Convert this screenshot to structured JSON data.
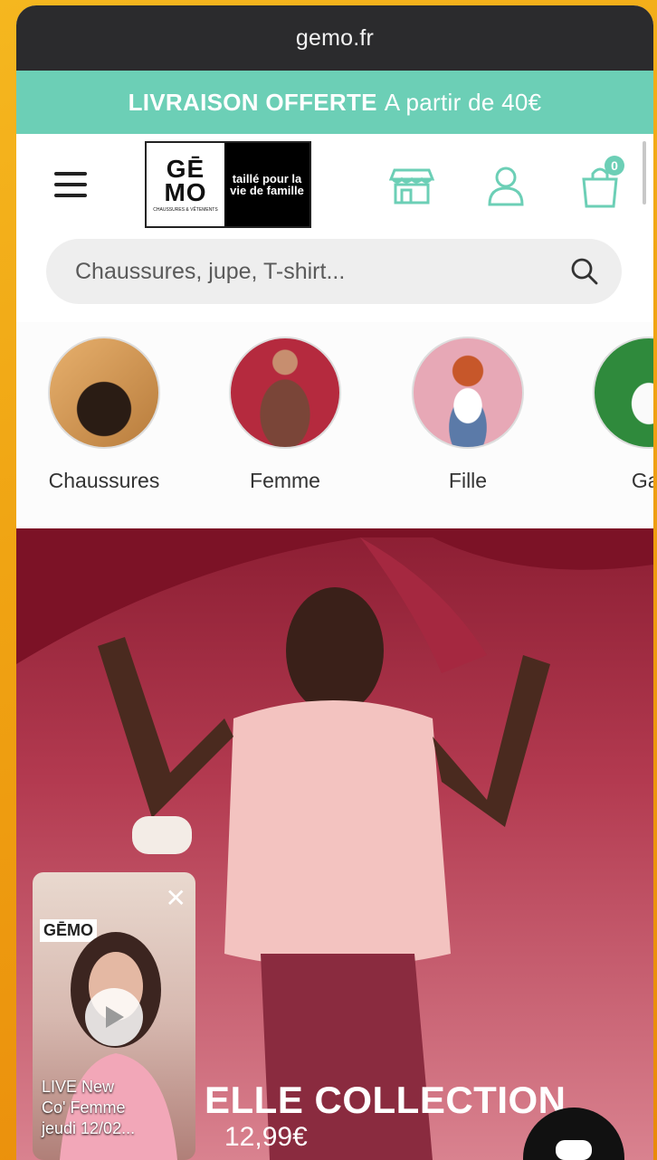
{
  "browser": {
    "url": "gemo.fr"
  },
  "promo": {
    "bold": "LIVRAISON OFFERTE",
    "rest": "A partir de 40€"
  },
  "header": {
    "logo_main_1": "GĒ",
    "logo_main_2": "MO",
    "logo_small": "CHAUSSURES & VÊTEMENTS",
    "logo_tagline": "taillé pour la vie de famille",
    "cart_count": "0"
  },
  "search": {
    "placeholder": "Chaussures, jupe, T-shirt..."
  },
  "categories": [
    {
      "label": "Chaussures"
    },
    {
      "label": "Femme"
    },
    {
      "label": "Fille"
    },
    {
      "label": "Gar"
    }
  ],
  "hero": {
    "title": "ELLE COLLECTION",
    "price": "12,99€"
  },
  "video": {
    "logo": "GĒMO",
    "caption_1": "LIVE New",
    "caption_2": "Co' Femme",
    "caption_3": "jeudi 12/02..."
  },
  "colors": {
    "accent": "#6ccfb6",
    "urlbar": "#2b2b2d",
    "hero": "#b33a50"
  }
}
